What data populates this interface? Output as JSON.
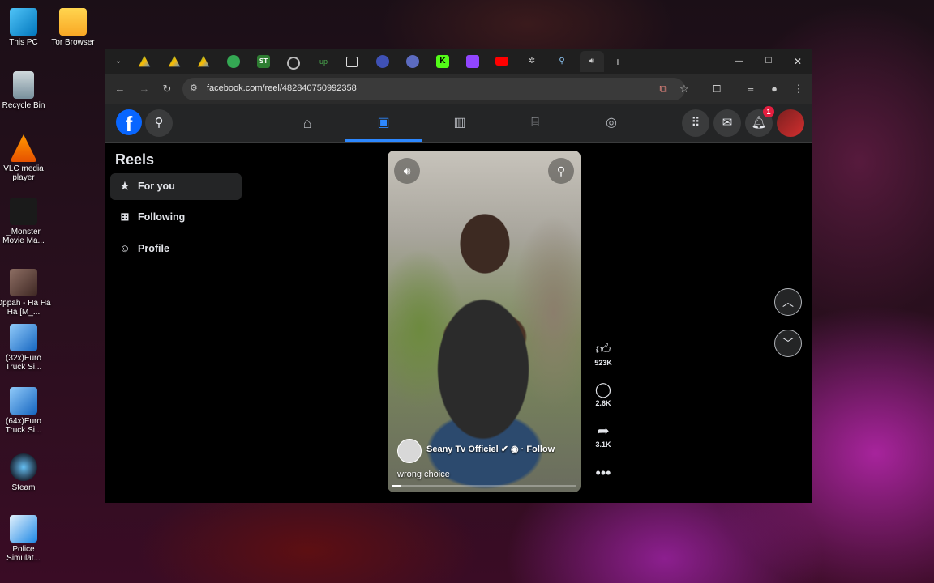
{
  "desktop": {
    "icons": [
      {
        "label": "This PC"
      },
      {
        "label": "Tor Browser"
      },
      {
        "label": "Recycle Bin"
      },
      {
        "label": "VLC media player"
      },
      {
        "label": "_Monster Movie Ma..."
      },
      {
        "label": "Oppah - Ha Ha Ha [M_..."
      },
      {
        "label": "(32x)Euro Truck Si..."
      },
      {
        "label": "(64x)Euro Truck Si..."
      },
      {
        "label": "Steam"
      },
      {
        "label": "Police Simulat..."
      }
    ]
  },
  "browser": {
    "url": "facebook.com/reel/482840750992358",
    "new_tab": "+",
    "tab_icons": [
      "google-drive-icon",
      "google-drive-icon",
      "google-drive-icon",
      "chrome-icon",
      "st-icon",
      "globe-icon",
      "upwork-icon",
      "screen-icon",
      "ai-icon",
      "ai-icon",
      "kick-icon",
      "twitch-icon",
      "youtube-icon",
      "extension-icon",
      "search-icon",
      "audio-icon"
    ]
  },
  "facebook": {
    "notification_count": "1",
    "sidebar": {
      "title": "Reels",
      "items": [
        {
          "label": "For you",
          "icon": "star-icon",
          "active": true
        },
        {
          "label": "Following",
          "icon": "following-icon",
          "active": false
        },
        {
          "label": "Profile",
          "icon": "profile-icon",
          "active": false
        }
      ]
    },
    "reel": {
      "author": "Seany Tv Officiel",
      "follow": "· Follow",
      "caption": "wrong choice",
      "progress": 0.05
    },
    "actions": {
      "likes": "523K",
      "comments": "2.6K",
      "shares": "3.1K"
    }
  }
}
